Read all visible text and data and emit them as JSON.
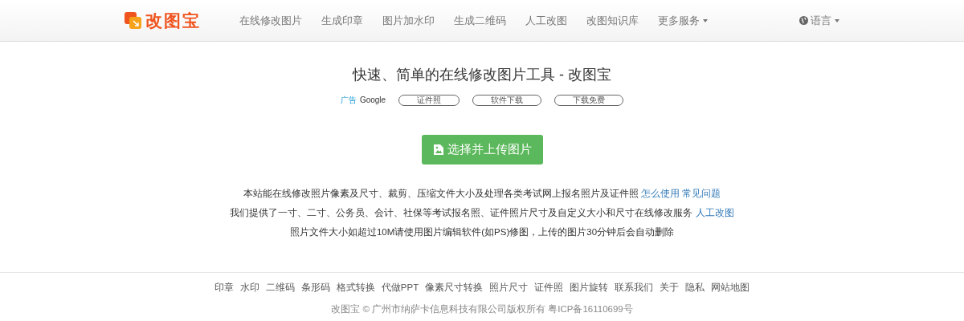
{
  "navbar": {
    "brand": "改图宝",
    "items": [
      {
        "label": "在线修改图片",
        "dropdown": false
      },
      {
        "label": "生成印章",
        "dropdown": false
      },
      {
        "label": "图片加水印",
        "dropdown": false
      },
      {
        "label": "生成二维码",
        "dropdown": false
      },
      {
        "label": "人工改图",
        "dropdown": false
      },
      {
        "label": "改图知识库",
        "dropdown": false
      },
      {
        "label": "更多服务",
        "dropdown": true
      }
    ],
    "language": {
      "label": "语言",
      "dropdown": true
    }
  },
  "main": {
    "title": "快速、简单的在线修改图片工具 - 改图宝",
    "ad": {
      "label": "广告",
      "provider": "Google",
      "keywords": [
        "证件照",
        "软件下载",
        "下载免费"
      ]
    },
    "upload_button": "选择并上传图片",
    "lines": [
      {
        "text": "本站能在线修改照片像素及尺寸、裁剪、压缩文件大小及处理各类考试网上报名照片及证件照",
        "links": [
          "怎么使用",
          "常见问题"
        ]
      },
      {
        "text": "我们提供了一寸、二寸、公务员、会计、社保等考试报名照、证件照片尺寸及自定义大小和尺寸在线修改服务",
        "links": [
          "人工改图"
        ]
      },
      {
        "text": "照片文件大小如超过10M请使用图片编辑软件(如PS)修图，上传的图片30分钟后会自动删除"
      }
    ]
  },
  "footer": {
    "links": [
      "印章",
      "水印",
      "二维码",
      "条形码",
      "格式转换",
      "代做PPT",
      "像素尺寸转换",
      "照片尺寸",
      "证件照",
      "图片旋转",
      "联系我们",
      "关于",
      "隐私",
      "网站地图"
    ],
    "copyright": "改图宝 © 广州市纳萨卡信息科技有限公司版权所有 粤ICP备16110699号"
  }
}
